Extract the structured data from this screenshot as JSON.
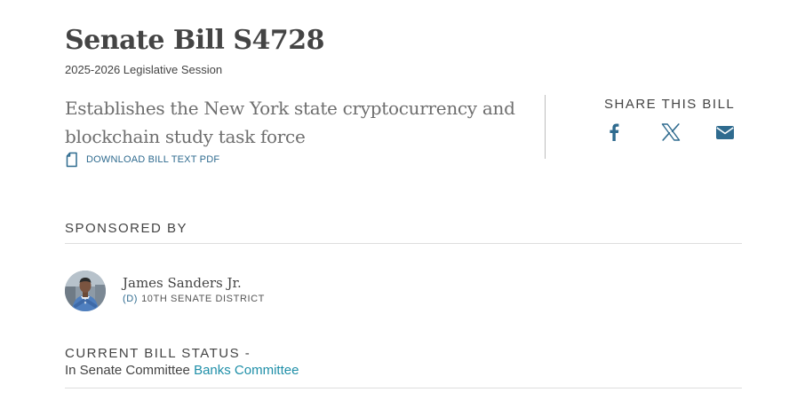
{
  "bill": {
    "title": "Senate Bill S4728",
    "session": "2025-2026 Legislative Session",
    "summary": "Establishes the New York state cryptocurrency and blockchain study task force",
    "download_label": "DOWNLOAD BILL TEXT PDF"
  },
  "share": {
    "heading": "SHARE THIS BILL",
    "icons": [
      "facebook-icon",
      "x-icon",
      "email-icon"
    ]
  },
  "sponsor": {
    "heading": "SPONSORED BY",
    "name": "James Sanders Jr.",
    "party": "(D)",
    "district": "10TH SENATE DISTRICT"
  },
  "status": {
    "heading": "CURRENT BILL STATUS -",
    "text": "In Senate Committee",
    "committee": "Banks Committee"
  },
  "colors": {
    "text": "#444444",
    "link": "#1f8fa8",
    "accent": "#2f6b8f",
    "muted": "#6e6e6e"
  }
}
